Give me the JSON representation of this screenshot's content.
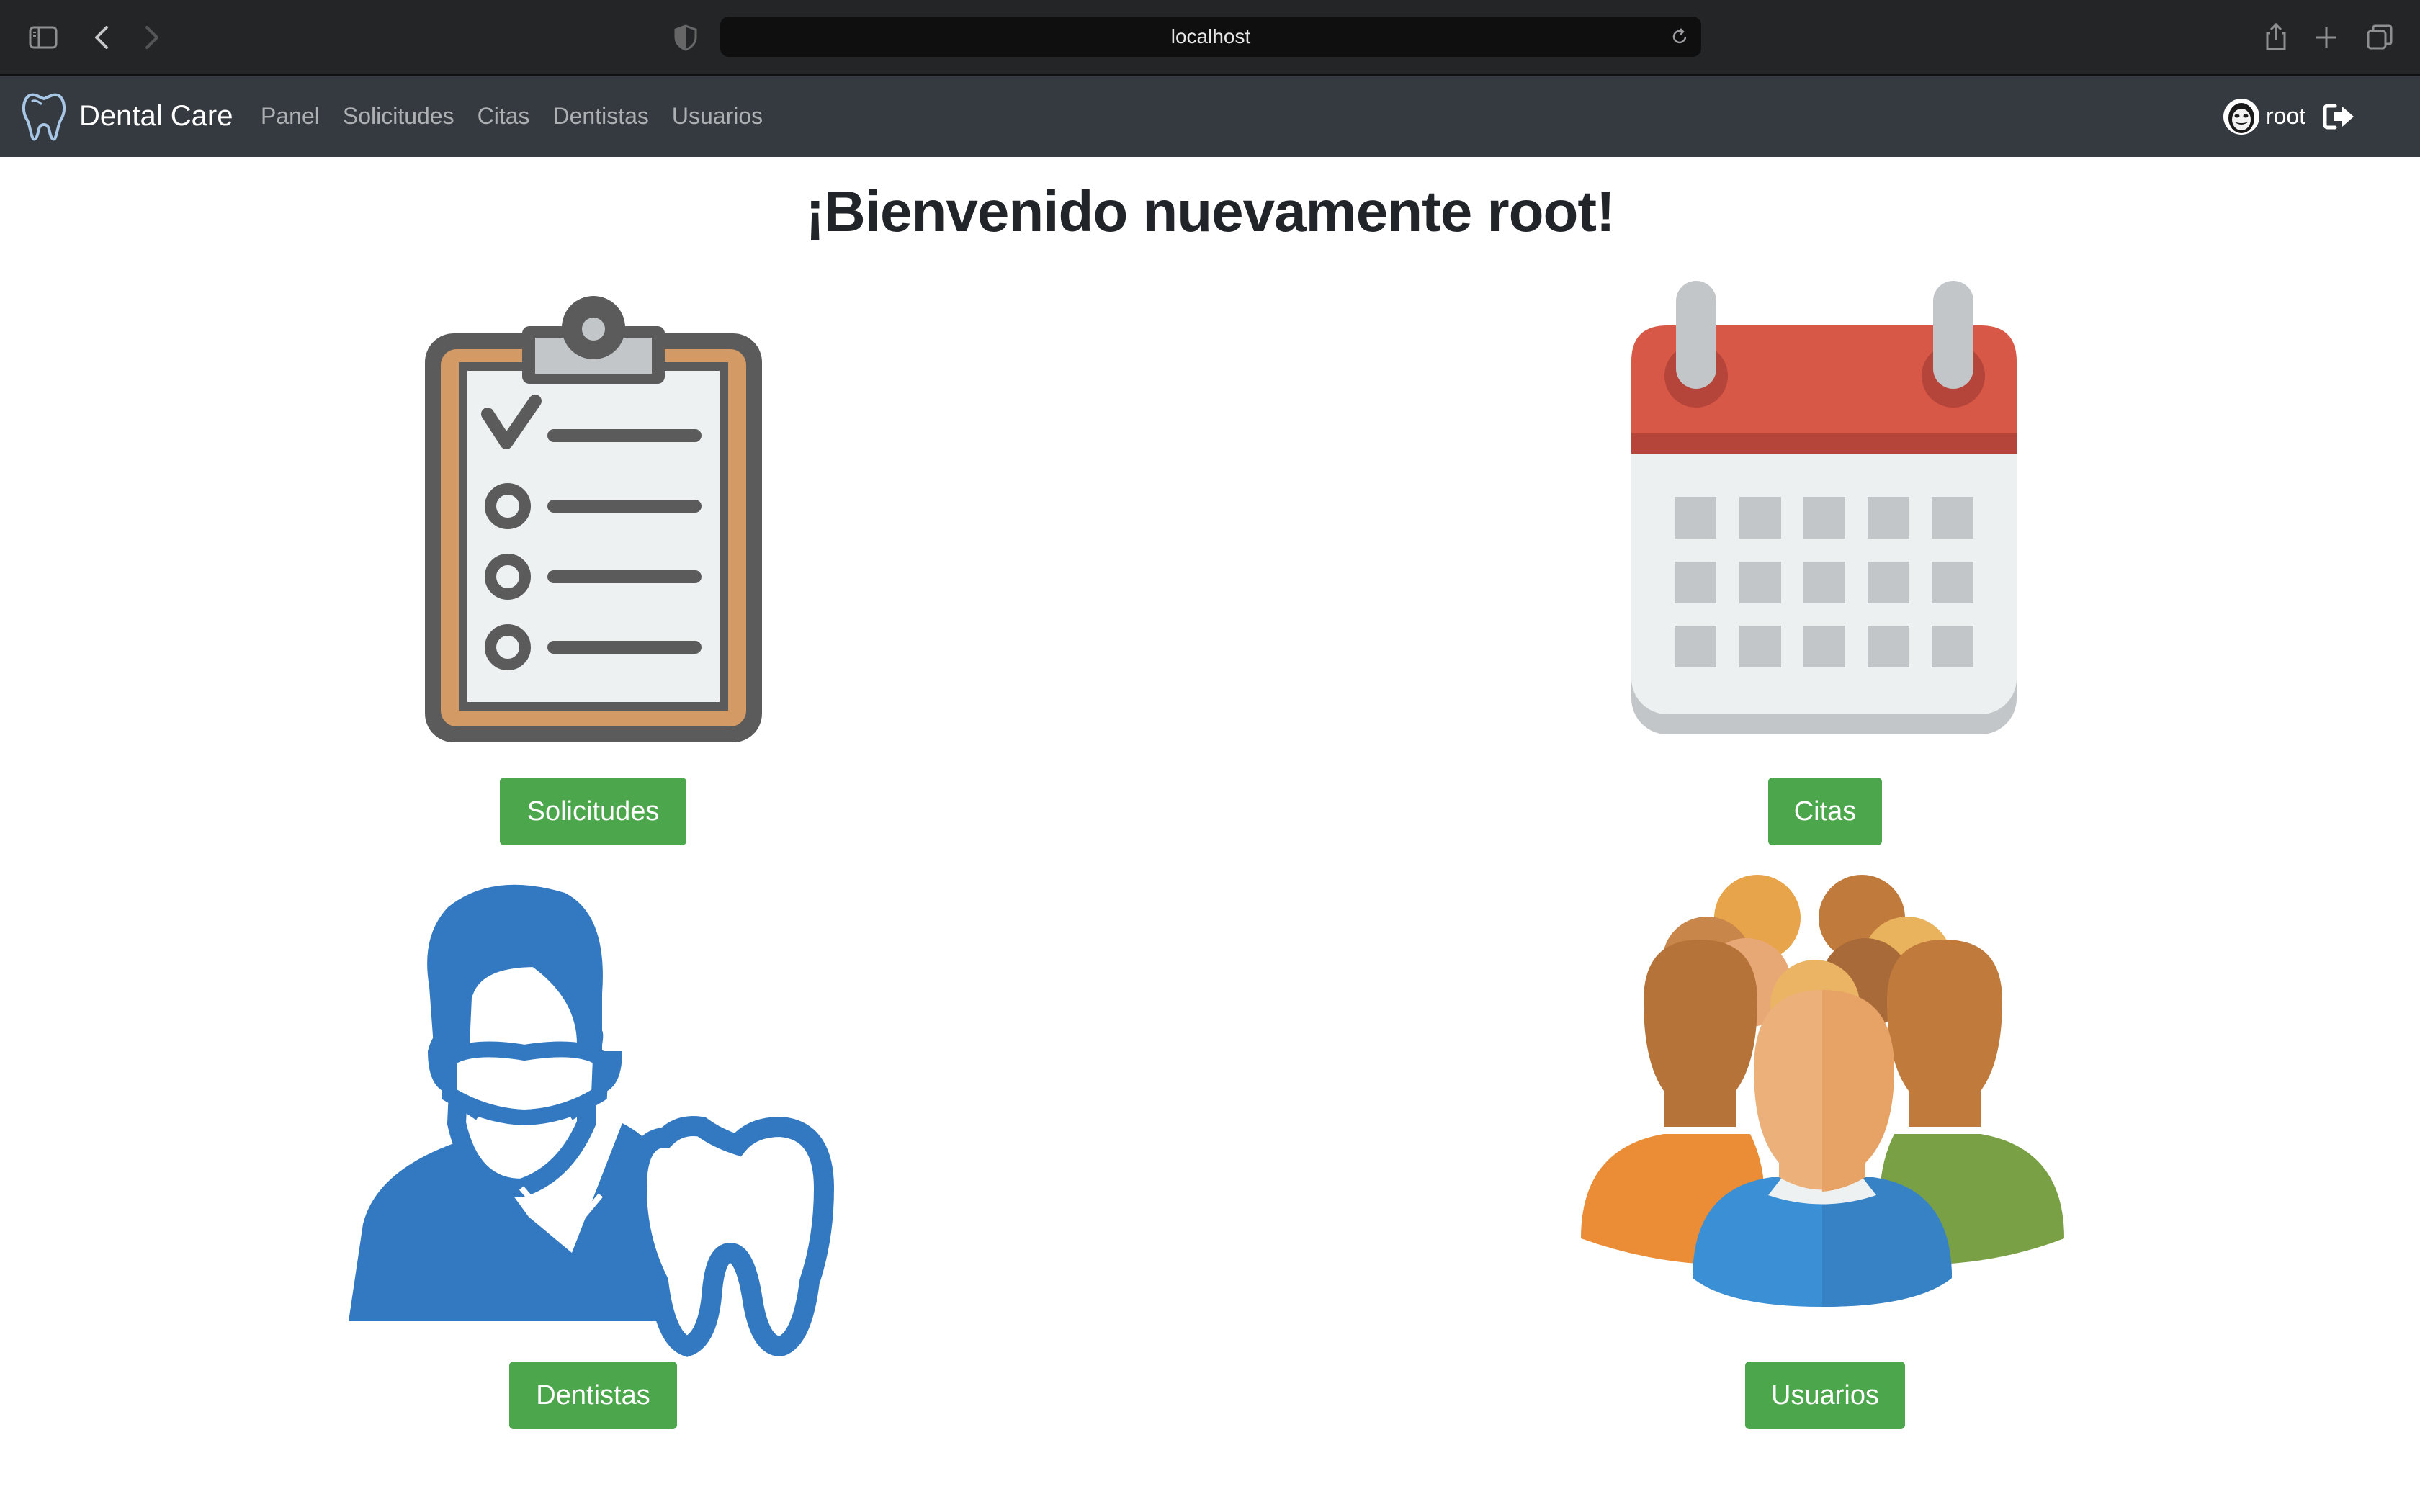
{
  "browser": {
    "url": "localhost",
    "icons": [
      "sidebar-icon",
      "back-icon",
      "forward-icon",
      "shield-icon",
      "reload-icon",
      "share-icon",
      "new-tab-icon",
      "tabs-overview-icon"
    ]
  },
  "navbar": {
    "brand": "Dental Care",
    "brand_icon": "tooth-icon",
    "links": [
      "Panel",
      "Solicitudes",
      "Citas",
      "Dentistas",
      "Usuarios"
    ],
    "user": "root",
    "logout_icon": "sign-out-icon"
  },
  "main": {
    "welcome": "¡Bienvenido nuevamente root!",
    "cards": [
      {
        "label": "Solicitudes",
        "icon": "clipboard-checklist-icon"
      },
      {
        "label": "Citas",
        "icon": "calendar-icon"
      },
      {
        "label": "Dentistas",
        "icon": "dentist-tooth-icon"
      },
      {
        "label": "Usuarios",
        "icon": "users-group-icon"
      }
    ],
    "button_color": "#4ca64c"
  }
}
